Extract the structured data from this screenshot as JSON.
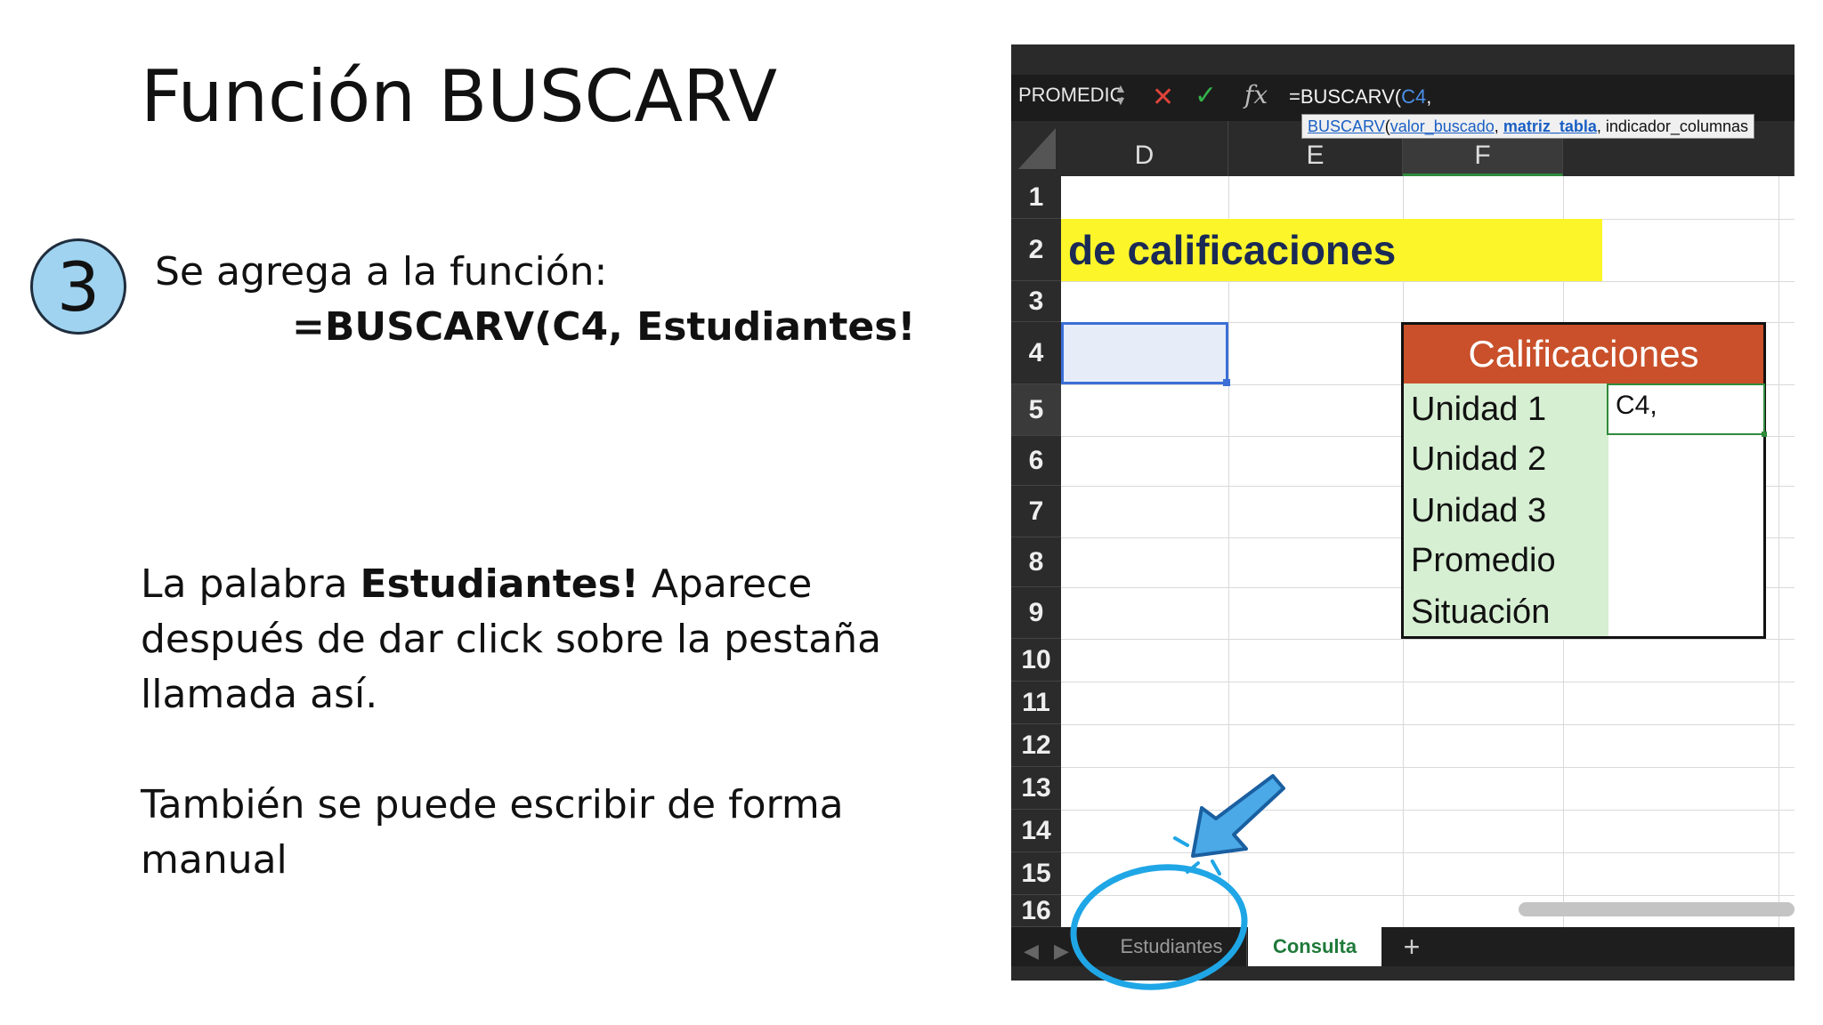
{
  "slide": {
    "title": "Función BUSCARV",
    "step_number": "3",
    "step_line1": "Se agrega a la función:",
    "step_line2": "=BUSCARV(C4, Estudiantes!",
    "para1_bold": "Estudiantes!",
    "para1_pre": "La palabra ",
    "para1_post": " Aparece después de dar click sobre la pestaña llamada así.",
    "para2": "También se puede escribir de forma manual"
  },
  "excel": {
    "name_box": "PROMEDIC",
    "formula_prefix": "=BUSCARV(",
    "formula_ref": "C4",
    "formula_suffix": ",",
    "tooltip": {
      "fn": "BUSCARV",
      "open": "(",
      "arg1": "valor_buscado",
      "sep1": ", ",
      "arg2": "matriz_tabla",
      "sep2": ", ",
      "arg3": "indicador_columnas"
    },
    "columns": [
      "D",
      "E",
      "F"
    ],
    "rows": [
      "1",
      "2",
      "3",
      "4",
      "5",
      "6",
      "7",
      "8",
      "9",
      "10",
      "11",
      "12",
      "13",
      "14",
      "15",
      "16"
    ],
    "title_band": "de calificaciones",
    "table": {
      "header": "Calificaciones",
      "labels": [
        "Unidad 1",
        "Unidad 2",
        "Unidad 3",
        "Promedio",
        "Situación"
      ],
      "active_value": "C4,"
    },
    "tabs": {
      "sheet1": "Estudiantes",
      "sheet2": "Consulta",
      "add": "+"
    },
    "colors": {
      "title_band": "#fbf52a",
      "table_header": "#c9502a",
      "label_fill": "#d6efd2",
      "annotation": "#1fa6e6"
    }
  }
}
